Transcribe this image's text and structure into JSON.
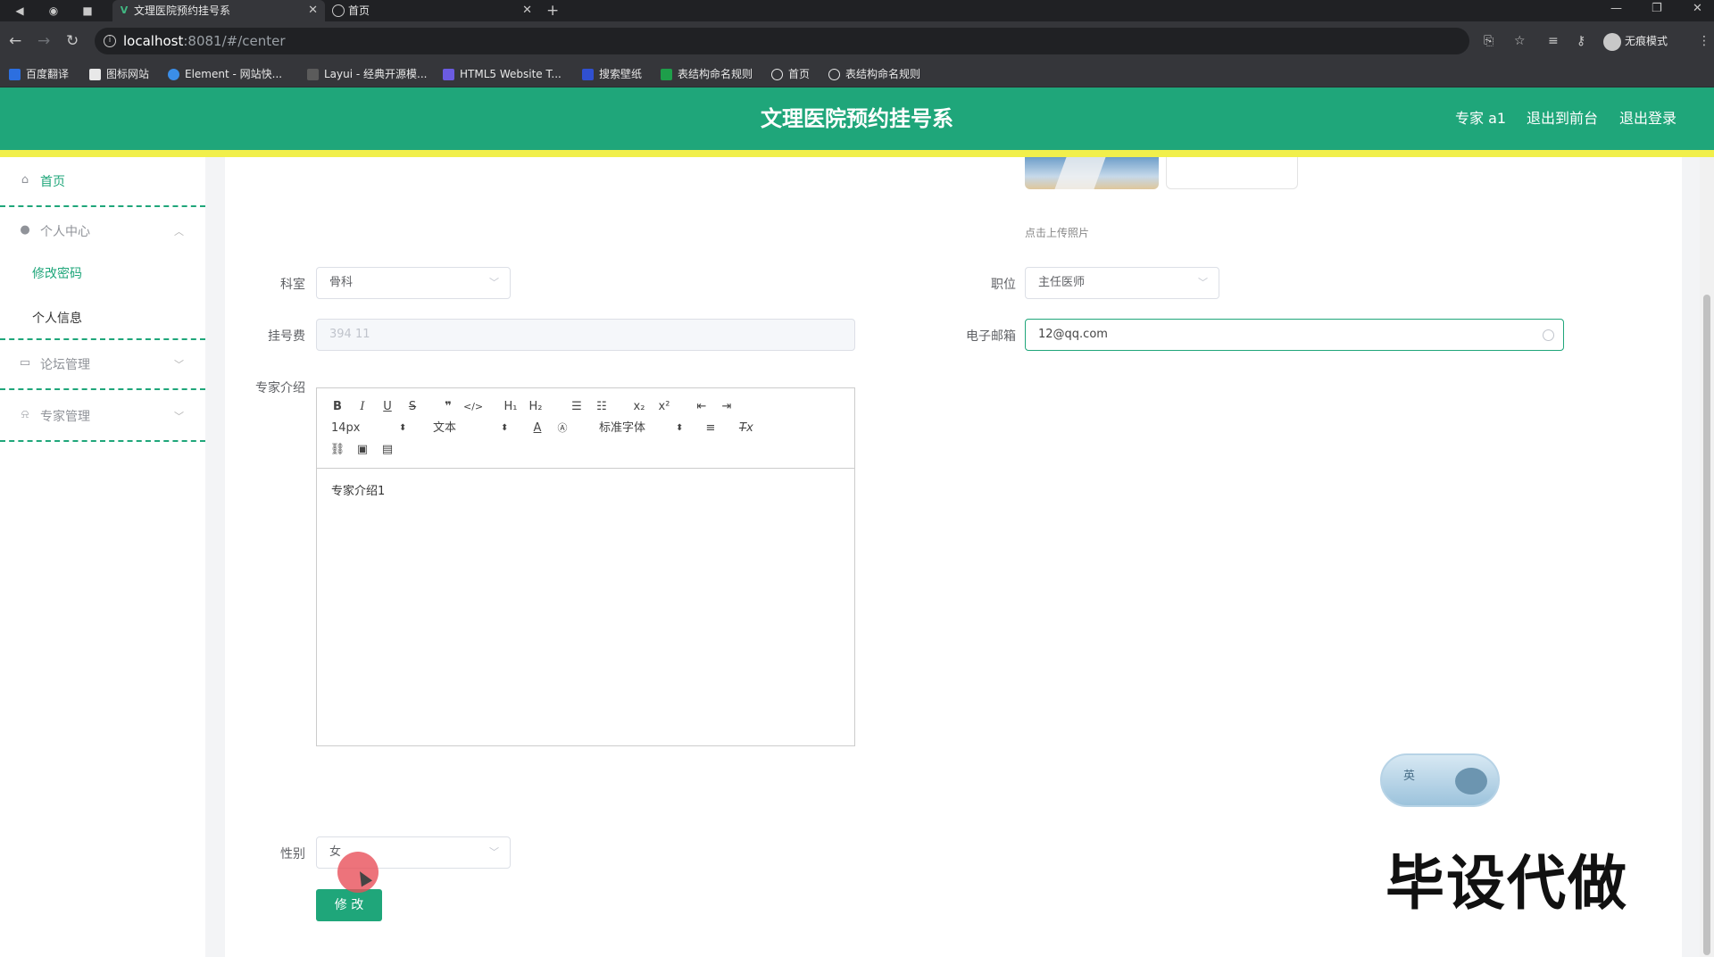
{
  "browser": {
    "tabs": [
      {
        "title": "文理医院预约挂号系",
        "active": true
      },
      {
        "title": "首页",
        "active": false
      }
    ],
    "url_host": "localhost",
    "url_rest": ":8081/#/center",
    "incognito_label": "无痕模式",
    "bookmarks": [
      "百度翻译",
      "图标网站",
      "Element - 网站快...",
      "Layui - 经典开源模...",
      "HTML5 Website T...",
      "搜索壁纸",
      "表结构命名规则",
      "首页",
      "表结构命名规则"
    ]
  },
  "header": {
    "title": "文理医院预约挂号系",
    "user": "专家 a1",
    "front_link": "退出到前台",
    "logout_link": "退出登录",
    "color": "#1fa67a"
  },
  "sidebar": {
    "home": "首页",
    "personal_center": "个人中心",
    "change_password": "修改密码",
    "personal_info": "个人信息",
    "forum_mgmt": "论坛管理",
    "expert_mgmt": "专家管理"
  },
  "form": {
    "upload_hint": "点击上传照片",
    "department_label": "科室",
    "department_value": "骨科",
    "position_label": "职位",
    "position_value": "主任医师",
    "fee_label": "挂号费",
    "fee_value": "394 11",
    "email_label": "电子邮箱",
    "email_value": "12@qq.com",
    "intro_label": "专家介绍",
    "intro_content": "专家介绍1",
    "gender_label": "性别",
    "gender_value": "女",
    "submit_label": "修 改"
  },
  "editor_toolbar": {
    "font_size": "14px",
    "text_type": "文本",
    "font_family": "标准字体",
    "h1": "H₁",
    "h2": "H₂",
    "sub": "x₂",
    "sup": "x²"
  },
  "overlay": {
    "ime_char": "英",
    "watermark": "毕设代做"
  }
}
